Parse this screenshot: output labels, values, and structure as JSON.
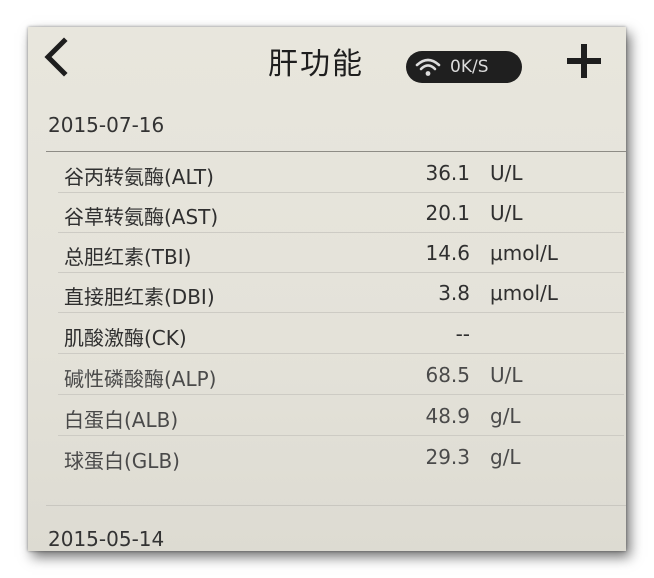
{
  "header": {
    "title": "肝功能",
    "network_speed": "0K/S",
    "back_icon": "chevron-left-icon",
    "add_icon": "plus-icon",
    "wifi_icon": "wifi-icon"
  },
  "records": [
    {
      "date": "2015-07-16",
      "items": [
        {
          "name": "谷丙转氨酶(ALT)",
          "value": "36.1",
          "unit": "U/L"
        },
        {
          "name": "谷草转氨酶(AST)",
          "value": "20.1",
          "unit": "U/L"
        },
        {
          "name": "总胆红素(TBI)",
          "value": "14.6",
          "unit": "μmol/L"
        },
        {
          "name": "直接胆红素(DBI)",
          "value": "3.8",
          "unit": "μmol/L"
        },
        {
          "name": "肌酸激酶(CK)",
          "value": "--",
          "unit": ""
        },
        {
          "name": "碱性磷酸酶(ALP)",
          "value": "68.5",
          "unit": "U/L"
        },
        {
          "name": "白蛋白(ALB)",
          "value": "48.9",
          "unit": "g/L"
        },
        {
          "name": "球蛋白(GLB)",
          "value": "29.3",
          "unit": "g/L"
        }
      ]
    },
    {
      "date": "2015-05-14",
      "items": []
    }
  ],
  "colors": {
    "screen_bg": "#e6e4db",
    "text": "#2f2f2f",
    "pill_bg": "#1f1f1f"
  }
}
